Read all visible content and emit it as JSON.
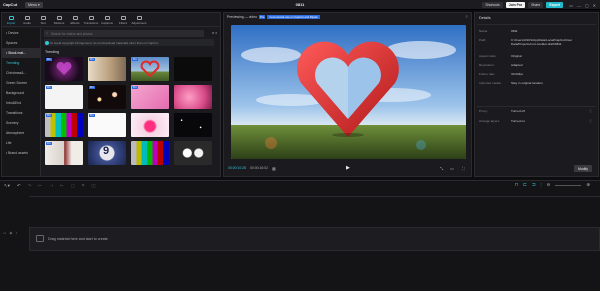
{
  "titlebar": {
    "app_name": "CapCut",
    "menu_label": "Menu ▾",
    "project_name": "0811",
    "shortcuts": "Shortcuts",
    "join_pro": "Join Pro",
    "share": "Share",
    "export": "Export"
  },
  "toolbar": {
    "tools": [
      "Import",
      "Audio",
      "Text",
      "Stickers",
      "Effects",
      "Transitions",
      "Captions",
      "Filters",
      "Adjustment"
    ],
    "active": "Import"
  },
  "sidebar": {
    "items": [
      "• Device",
      "Spaces",
      "• Stock mat...",
      "Trending",
      "Christmas&...",
      "Green Screen",
      "Background",
      "Intro&End",
      "Transitions",
      "Scenery",
      "Atmosphere",
      "Life",
      "• Brand assets"
    ]
  },
  "library": {
    "search_placeholder": "Search for videos and photos",
    "filter_label": "⇅ ▾",
    "notice": "To avoid copyright infringement, do not download materials other than on CapCut.",
    "section_title": "Trending"
  },
  "preview": {
    "heading": "Previewing — video",
    "badge": "Pro",
    "commercial": "Commercial use on CapCut and Ripple",
    "time_current": "00:00:10:28",
    "time_total": "00:00:16:02",
    "play_icon": "▶"
  },
  "details": {
    "title": "Details",
    "rows": [
      {
        "label": "Name:",
        "value": "0811"
      },
      {
        "label": "Path:",
        "value": "C:/Users/ASUS/AppData/Local/CapCut/User Data/Projects/com.lveditor.draft/0811"
      },
      {
        "label": "Aspect ratio:",
        "value": "Original"
      },
      {
        "label": "Resolution:",
        "value": "Adapted"
      },
      {
        "label": "Frame rate:",
        "value": "30.00fps"
      },
      {
        "label": "Imported media:",
        "value": "Stay in original location"
      },
      {
        "label": "Proxy:",
        "value": "Turned off"
      },
      {
        "label": "Arrange layers:",
        "value": "Turned on"
      }
    ],
    "modify": "Modify"
  },
  "timeline": {
    "drop_hint": "Drag material here and start to create"
  },
  "colors": {
    "accent": "#2fc6d6",
    "export": "#22b8c8",
    "badge": "#2d6cdf"
  }
}
